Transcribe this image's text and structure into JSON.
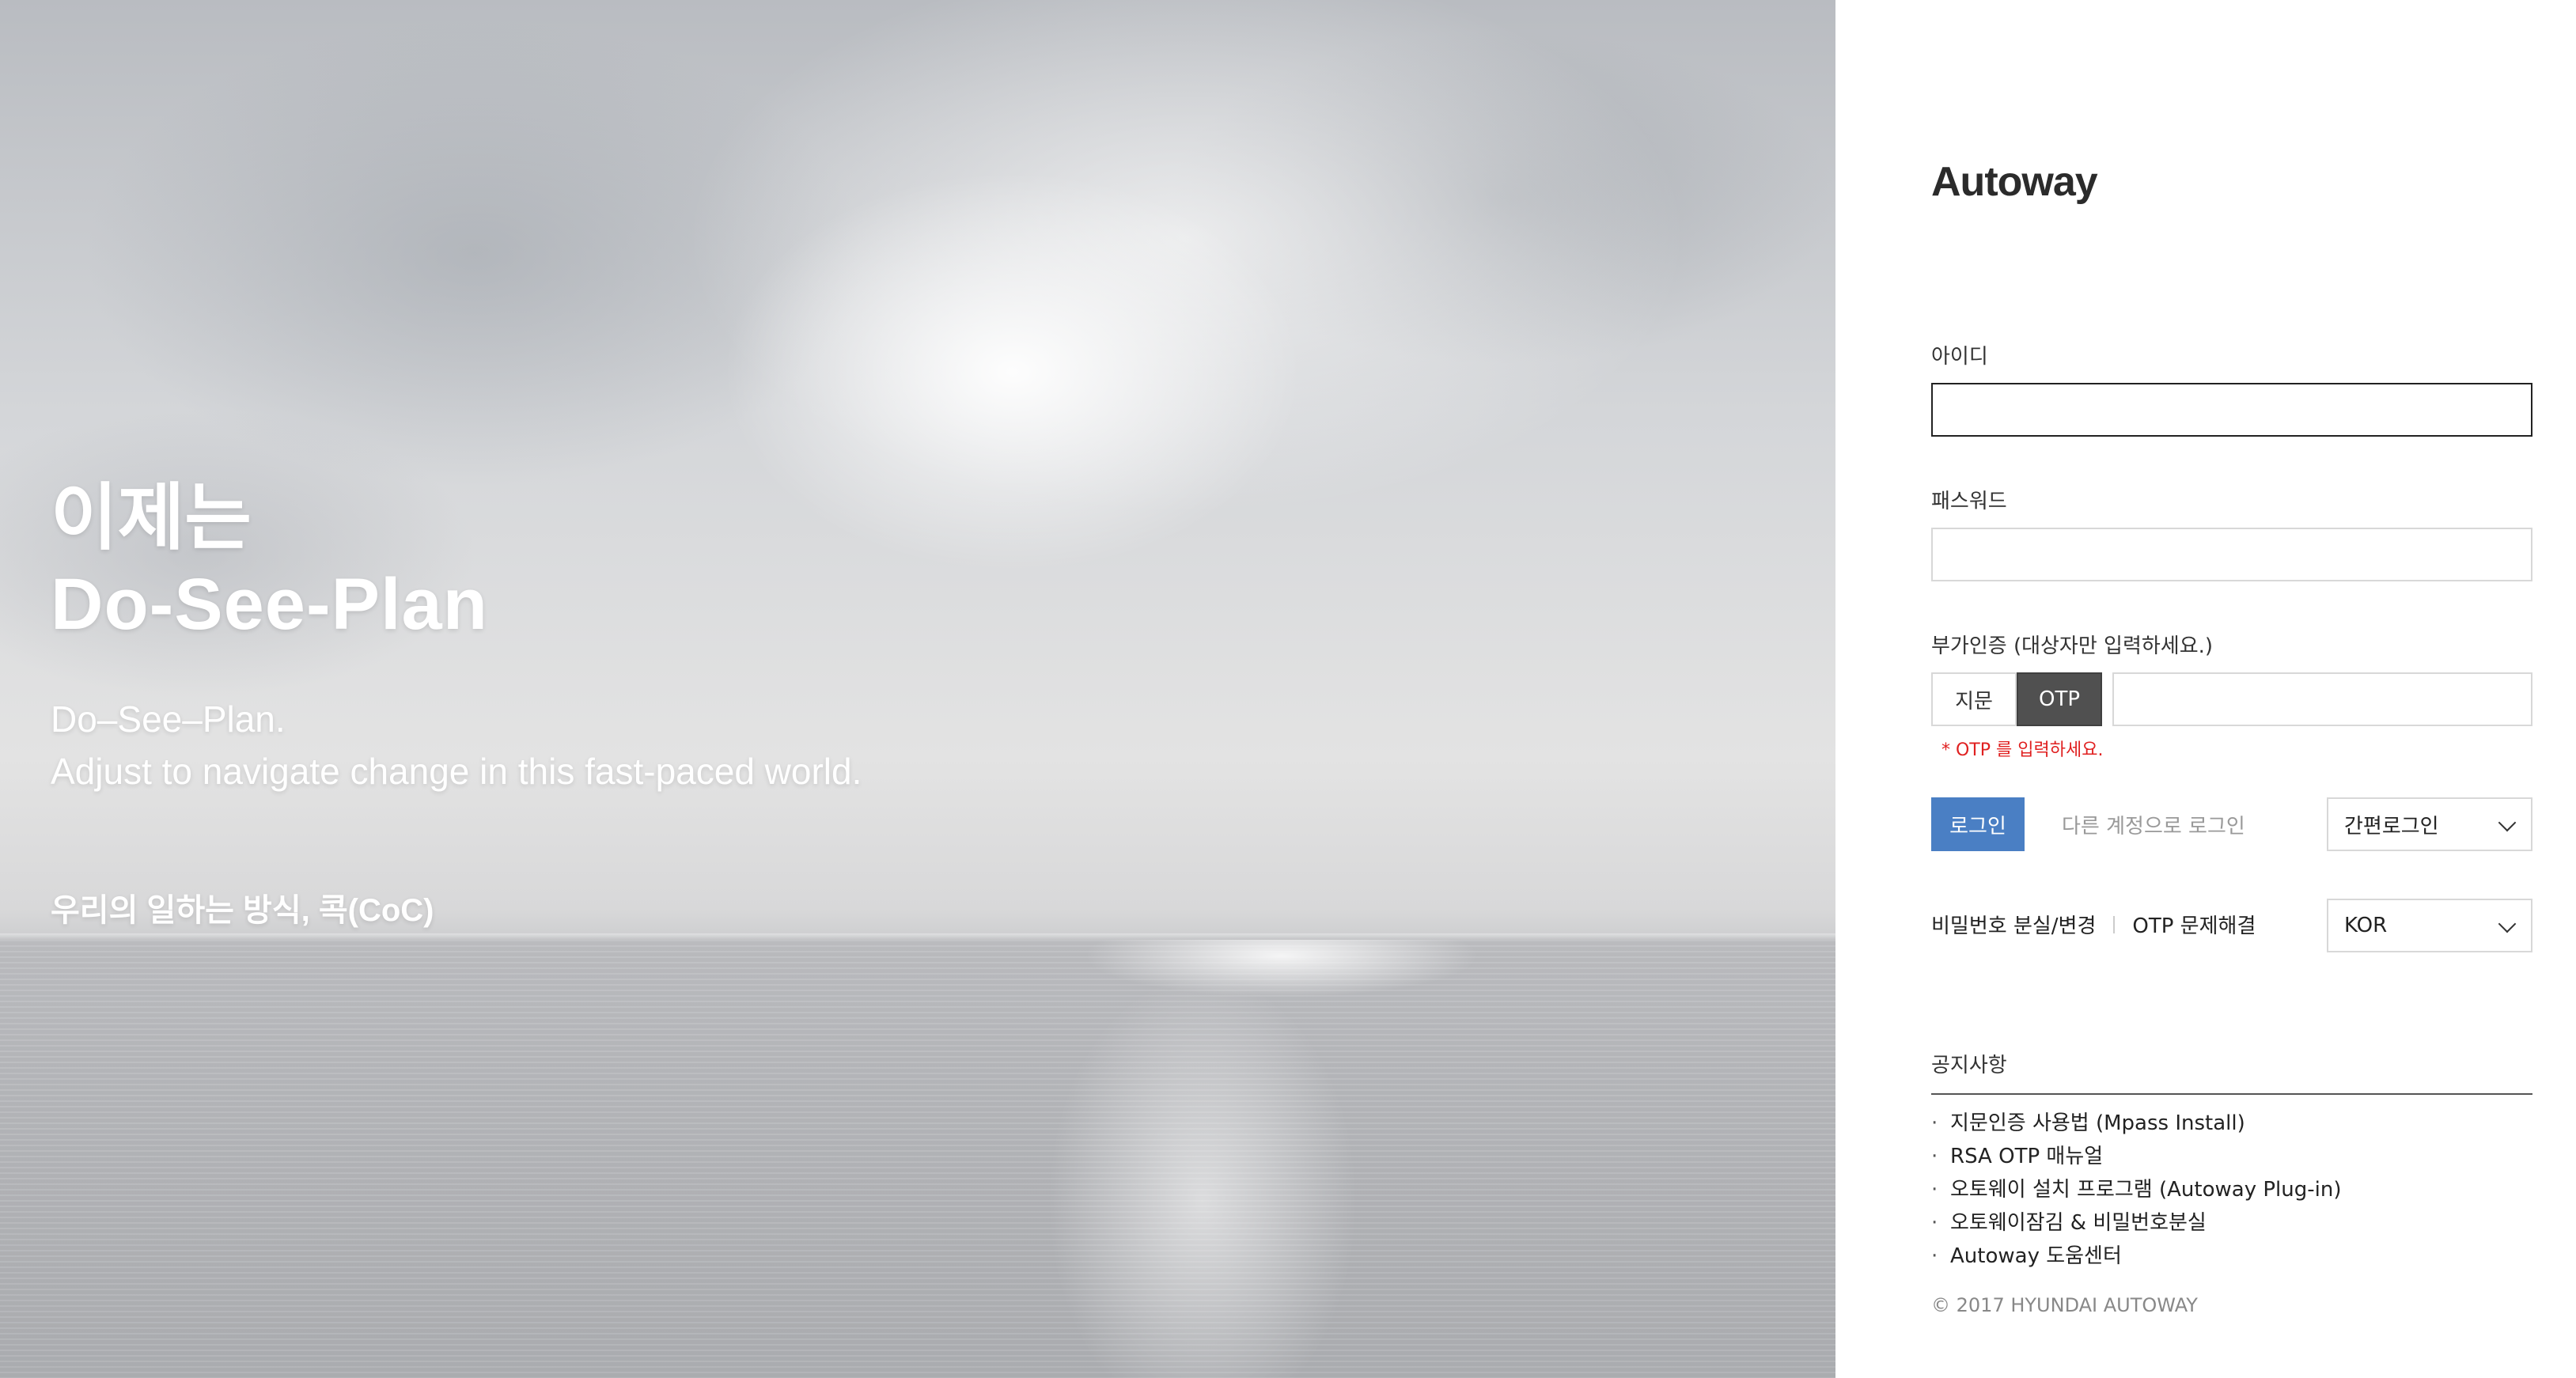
{
  "hero": {
    "title_line1": "이제는",
    "title_line2": "Do-See-Plan",
    "subtitle_line1": "Do–See–Plan.",
    "subtitle_line2": "Adjust to navigate change in this fast-paced world.",
    "coc_text": "우리의 일하는 방식, 콕(CoC)"
  },
  "login": {
    "logo": "Autoway",
    "id_label": "아이디",
    "id_value": "",
    "password_label": "패스워드",
    "password_value": "",
    "auth_label": "부가인증 (대상자만 입력하세요.)",
    "auth_options": [
      "지문",
      "OTP"
    ],
    "auth_selected": "OTP",
    "otp_value": "",
    "otp_error": "* OTP 를 입력하세요.",
    "login_button": "로그인",
    "alt_login": "다른 계정으로 로그인",
    "simple_login_select": "간편로그인",
    "language_select": "KOR",
    "password_reset_link": "비밀번호 분실/변경",
    "otp_help_link": "OTP 문제해결"
  },
  "notices": {
    "title": "공지사항",
    "items": [
      "지문인증 사용법 (Mpass Install)",
      "RSA OTP 매뉴얼",
      "오토웨이 설치 프로그램 (Autoway Plug-in)",
      "오토웨이잠김 & 비밀번호분실",
      "Autoway 도움센터"
    ]
  },
  "footer": {
    "copyright": "© 2017 HYUNDAI AUTOWAY"
  },
  "colors": {
    "login_button_bg": "#4a7fc4",
    "otp_active_bg": "#505050",
    "error_text": "#e02020"
  }
}
